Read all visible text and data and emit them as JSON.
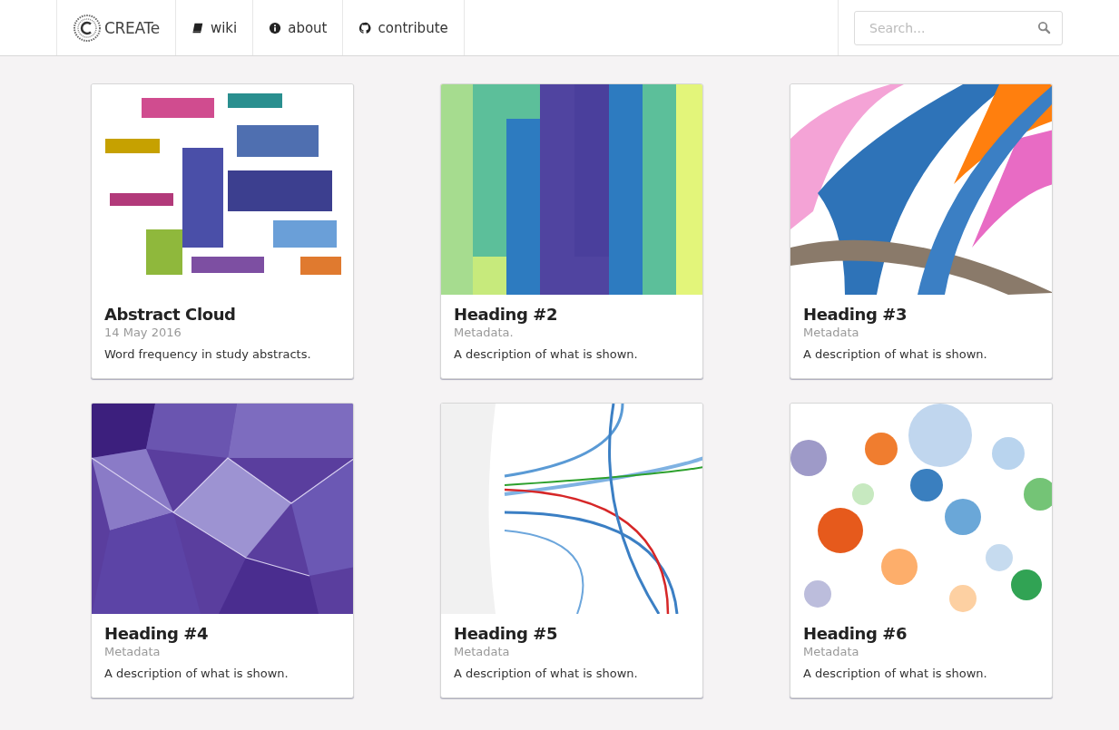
{
  "navbar": {
    "brand": "CREATe",
    "links": [
      {
        "label": "wiki"
      },
      {
        "label": "about"
      },
      {
        "label": "contribute"
      }
    ],
    "search": {
      "placeholder": "Search..."
    }
  },
  "cards": [
    {
      "kind": "picture",
      "title": "Abstract Cloud",
      "meta": "14 May 2016",
      "description": "Word frequency in study abstracts."
    },
    {
      "kind": "picture",
      "title": "Heading #2",
      "meta": "Metadata.",
      "description": "A description of what is shown."
    },
    {
      "kind": "picture",
      "title": "Heading #3",
      "meta": "Metadata",
      "description": "A description of what is shown."
    },
    {
      "kind": "picture",
      "title": "Heading #4",
      "meta": "Metadata",
      "description": "A description of what is shown."
    },
    {
      "kind": "picture",
      "title": "Heading #5",
      "meta": "Metadata",
      "description": "A description of what is shown."
    },
    {
      "kind": "picture",
      "title": "Heading #6",
      "meta": "Metadata",
      "description": "A description of what is shown."
    }
  ]
}
